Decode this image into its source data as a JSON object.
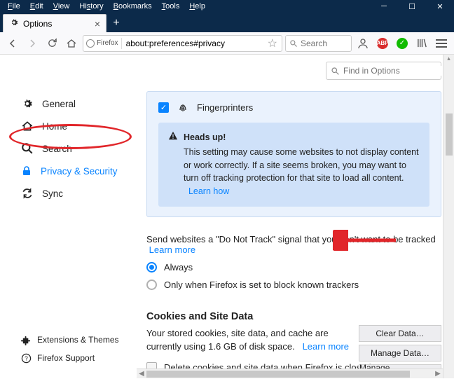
{
  "menu": [
    "File",
    "Edit",
    "View",
    "History",
    "Bookmarks",
    "Tools",
    "Help"
  ],
  "tab": {
    "title": "Options"
  },
  "url": {
    "identity": "Firefox",
    "value": "about:preferences#privacy"
  },
  "searchPlaceholder": "Search",
  "findPlaceholder": "Find in Options",
  "nav": {
    "general": "General",
    "home": "Home",
    "search": "Search",
    "privacy": "Privacy & Security",
    "sync": "Sync",
    "ext": "Extensions & Themes",
    "support": "Firefox Support"
  },
  "fp": {
    "label": "Fingerprinters"
  },
  "alert": {
    "title": "Heads up!",
    "body": "This setting may cause some websites to not display content or work correctly. If a site seems broken, you may want to turn off tracking protection for that site to load all content.",
    "learn": "Learn how"
  },
  "dnt": {
    "text": "Send websites a \"Do Not Track\" signal that you don't want to be tracked",
    "learn": "Learn more",
    "opt1": "Always",
    "opt2": "Only when Firefox is set to block known trackers"
  },
  "cookies": {
    "title": "Cookies and Site Data",
    "desc1": "Your stored cookies, site data, and cache are currently using 1.6 GB of disk space.",
    "learn": "Learn more",
    "clear": "Clear Data…",
    "manage": "Manage Data…",
    "except": "Manage Exceptions…",
    "delOnClose": "Delete cookies and site data when Firefox is closed"
  }
}
